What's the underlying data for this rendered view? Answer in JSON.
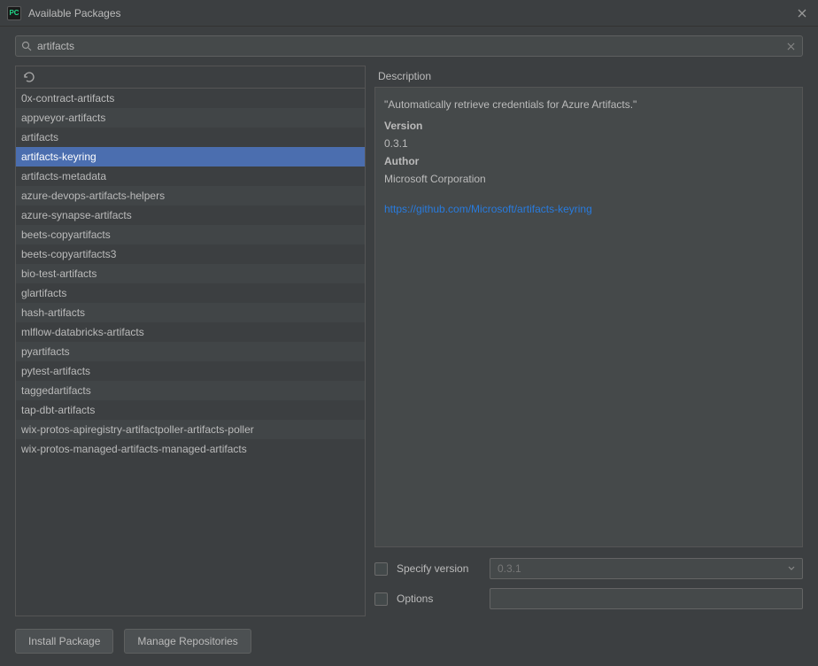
{
  "window": {
    "title": "Available Packages",
    "app_code": "PC"
  },
  "search": {
    "value": "artifacts"
  },
  "packages": [
    {
      "name": "0x-contract-artifacts",
      "selected": false
    },
    {
      "name": "appveyor-artifacts",
      "selected": false
    },
    {
      "name": "artifacts",
      "selected": false
    },
    {
      "name": "artifacts-keyring",
      "selected": true
    },
    {
      "name": "artifacts-metadata",
      "selected": false
    },
    {
      "name": "azure-devops-artifacts-helpers",
      "selected": false
    },
    {
      "name": "azure-synapse-artifacts",
      "selected": false
    },
    {
      "name": "beets-copyartifacts",
      "selected": false
    },
    {
      "name": "beets-copyartifacts3",
      "selected": false
    },
    {
      "name": "bio-test-artifacts",
      "selected": false
    },
    {
      "name": "glartifacts",
      "selected": false
    },
    {
      "name": "hash-artifacts",
      "selected": false
    },
    {
      "name": "mlflow-databricks-artifacts",
      "selected": false
    },
    {
      "name": "pyartifacts",
      "selected": false
    },
    {
      "name": "pytest-artifacts",
      "selected": false
    },
    {
      "name": "taggedartifacts",
      "selected": false
    },
    {
      "name": "tap-dbt-artifacts",
      "selected": false
    },
    {
      "name": "wix-protos-apiregistry-artifactpoller-artifacts-poller",
      "selected": false
    },
    {
      "name": "wix-protos-managed-artifacts-managed-artifacts",
      "selected": false
    }
  ],
  "description": {
    "header": "Description",
    "text": "\"Automatically retrieve credentials for Azure Artifacts.\"",
    "version_label": "Version",
    "version_value": "0.3.1",
    "author_label": "Author",
    "author_value": "Microsoft Corporation",
    "link": "https://github.com/Microsoft/artifacts-keyring"
  },
  "options": {
    "specify_version_label": "Specify version",
    "specify_version_value": "0.3.1",
    "options_label": "Options",
    "options_value": ""
  },
  "buttons": {
    "install": "Install Package",
    "manage": "Manage Repositories"
  }
}
